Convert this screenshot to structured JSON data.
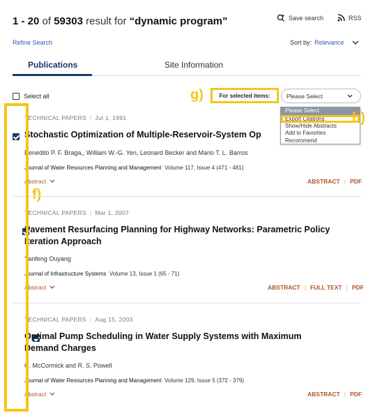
{
  "header": {
    "range": "1 - 20",
    "of": "of",
    "total": "59303",
    "result_for": "result for",
    "query": "“dynamic program”",
    "save_search": "Save search",
    "rss": "RSS"
  },
  "toolbar": {
    "refine": "Refine Search",
    "sort_label": "Sort by:",
    "sort_value": "Relevance"
  },
  "tabs": [
    {
      "label": "Publications",
      "active": true
    },
    {
      "label": "Site Information",
      "active": false
    }
  ],
  "selection": {
    "select_all": "Select all",
    "for_selected": "For selected items:",
    "select_value": "Please Select",
    "options": [
      "Please Select",
      "Export Citations",
      "Show/Hide Abstracts",
      "Add to Favorites",
      "Recommend"
    ]
  },
  "annotations": {
    "f": "f)",
    "g": "g)",
    "h": "h)"
  },
  "results": [
    {
      "type": "TECHNICAL PAPERS",
      "date": "Jul 1, 1991",
      "title": "Stochastic Optimization of Multiple-Reservoir-System Op",
      "authors": "Benedito P. F. Braga,, William W.-G. Yen, Leonard Becker and Mario T. L. Barros",
      "journal": "Journal of Water Resources Planning and Management",
      "volume": "Volume 117, Issue 4 (471 - 481)",
      "abstract_toggle": "Abstract",
      "links": [
        "ABSTRACT",
        "PDF"
      ]
    },
    {
      "type": "TECHNICAL PAPERS",
      "date": "Mar 1, 2007",
      "title_line1": "Pavement Resurfacing Planning for Highway Networks: Parametric Policy",
      "title_line2": "Iteration Approach",
      "authors": "Yanfeng Ouyang",
      "journal": "Journal of Infrastructure Systems",
      "volume": "Volume 13, Issue 1 (65 - 71)",
      "abstract_toggle": "Abstract",
      "links": [
        "ABSTRACT",
        "FULL TEXT",
        "PDF"
      ]
    },
    {
      "type": "TECHNICAL PAPERS",
      "date": "Aug 15, 2003",
      "title_line1": "Optimal Pump Scheduling in Water Supply Systems with Maximum",
      "title_line2": "Demand Charges",
      "authors": "C. McCormick and R. S. Powell",
      "journal": "Journal of Water Resources Planning and Management",
      "volume": "Volume 129, Issue 5 (372 - 379)",
      "abstract_toggle": "Abstract",
      "links": [
        "ABSTRACT",
        "PDF"
      ]
    }
  ],
  "colors": {
    "accent_navy": "#1a3a6e",
    "link_blue": "#2a5db0",
    "link_rust": "#b0522a",
    "highlight_yellow": "#f5c518"
  }
}
